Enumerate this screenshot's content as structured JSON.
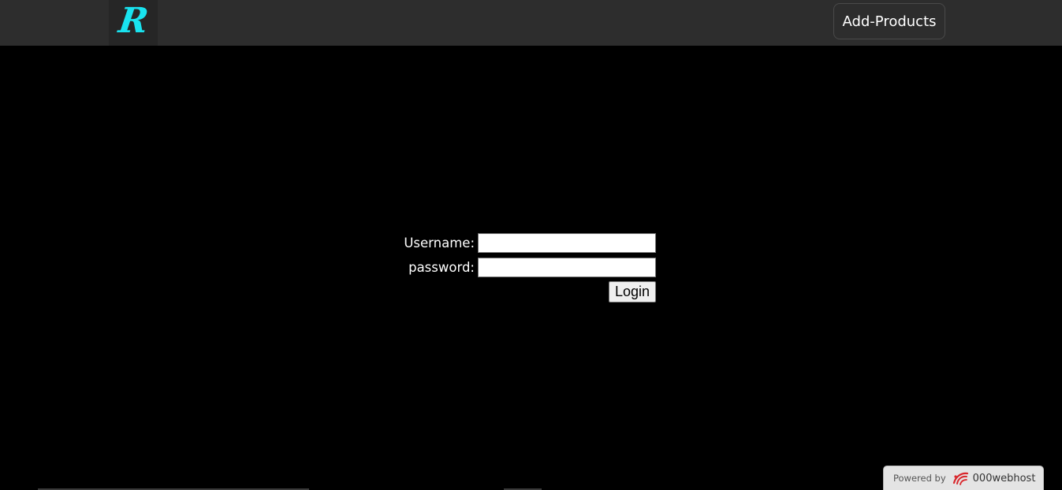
{
  "navbar": {
    "logo_letter": "R",
    "add_products_label": "Add-Products"
  },
  "login": {
    "username_label": "Username:",
    "username_value": "",
    "password_label": "password:",
    "password_value": "",
    "submit_label": "Login"
  },
  "footer_badge": {
    "powered_label": "Powered by",
    "host_name": "000webhost",
    "icon": "000webhost-logo-icon"
  },
  "colors": {
    "navbar_bg": "#2d2d2d",
    "page_bg": "#000000",
    "logo_accent": "#19e3ef",
    "host_icon": "#d9262b"
  }
}
